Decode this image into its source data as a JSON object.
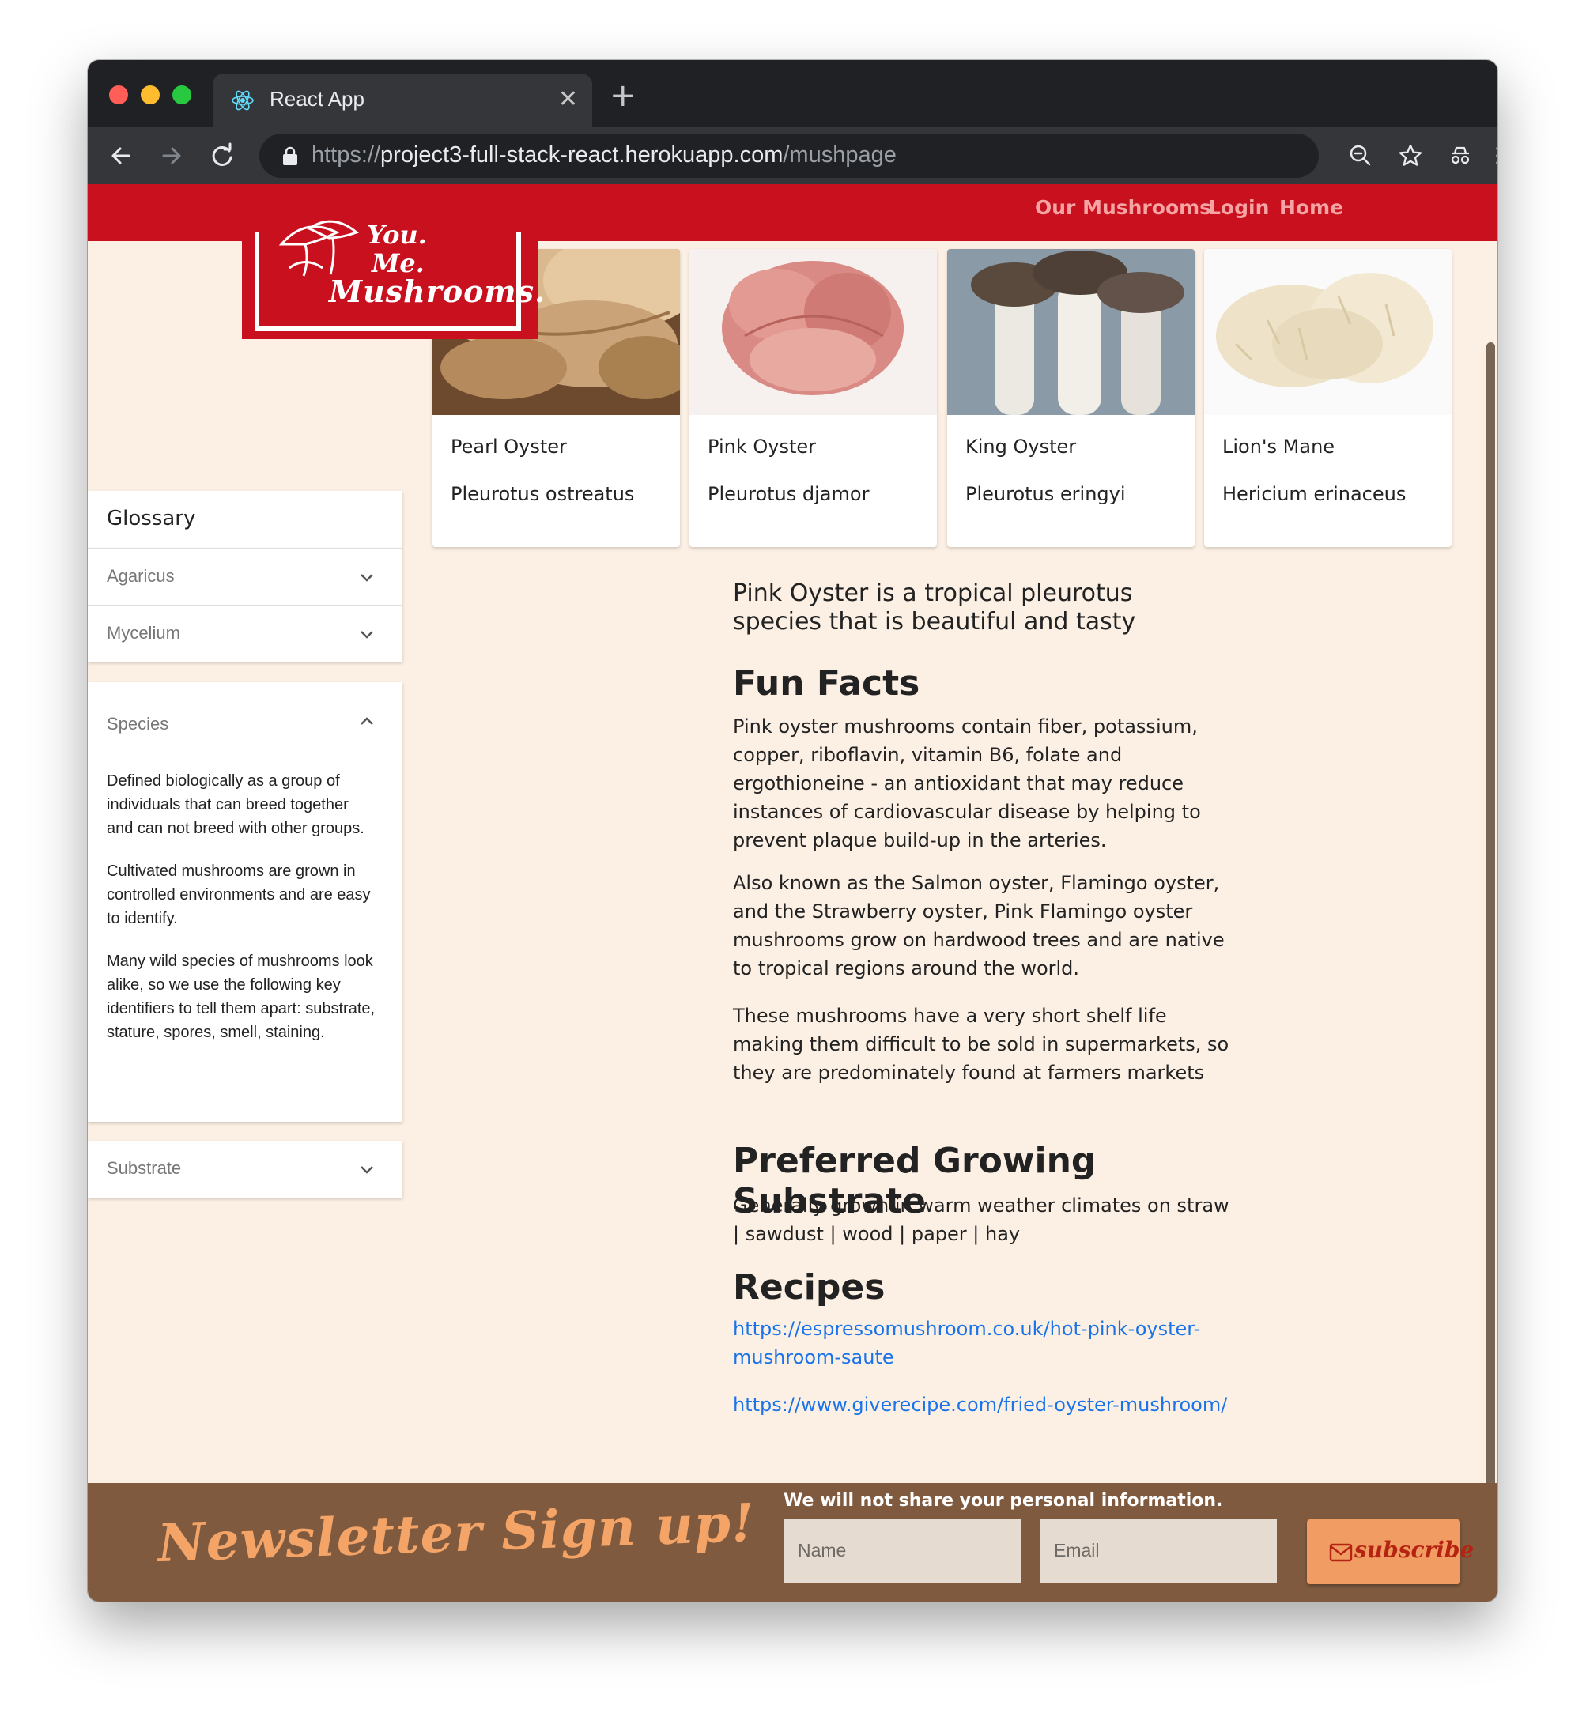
{
  "browser": {
    "tab_title": "React App",
    "url_scheme": "https://",
    "url_host": "project3-full-stack-react.herokuapp.com",
    "url_path": "/mushpage"
  },
  "nav": {
    "links": [
      "Our Mushrooms",
      "Login",
      "Home"
    ]
  },
  "logo": {
    "line1": "You.",
    "line2": "Me.",
    "line3": "Mushrooms."
  },
  "glossary": {
    "title": "Glossary",
    "items": [
      {
        "label": "Agaricus",
        "expanded": false
      },
      {
        "label": "Mycelium",
        "expanded": false
      },
      {
        "label": "Species",
        "expanded": true
      },
      {
        "label": "Substrate",
        "expanded": false
      }
    ],
    "species_body": [
      "Defined biologically as a group of individuals that can breed together and can not breed with other groups.",
      "Cultivated mushrooms are grown in controlled environments and are easy to identify.",
      "Many wild species of mushrooms look alike, so we use the following key identifiers to tell them apart: substrate, stature, spores, smell, staining."
    ]
  },
  "cards": [
    {
      "name": "Pearl Oyster",
      "scientific": "Pleurotus ostreatus"
    },
    {
      "name": "Pink Oyster",
      "scientific": "Pleurotus djamor"
    },
    {
      "name": "King Oyster",
      "scientific": "Pleurotus eringyi"
    },
    {
      "name": "Lion's Mane",
      "scientific": "Hericium erinaceus"
    }
  ],
  "detail": {
    "intro": "Pink Oyster is a tropical pleurotus species that is beautiful and tasty",
    "fun_facts_heading": "Fun Facts",
    "fun_facts": [
      "Pink oyster mushrooms contain fiber, potassium, copper, riboflavin, vitamin B6, folate and ergothioneine - an antioxidant that may reduce instances of cardiovascular disease by helping to prevent plaque build-up in the arteries.",
      "Also known as the Salmon oyster, Flamingo oyster, and the Strawberry oyster, Pink Flamingo oyster mushrooms grow on hardwood trees and are native to tropical regions around the world.",
      "These mushrooms have a very short shelf life making them difficult to be sold in supermarkets, so they are predominately found at farmers markets"
    ],
    "substrate_heading": "Preferred Growing Substrate",
    "substrate_text": "Generally grown in warm weather climates on straw | sawdust | wood | paper | hay",
    "recipes_heading": "Recipes",
    "recipes": [
      "https://espressomushroom.co.uk/hot-pink-oyster-mushroom-saute",
      "https://www.giverecipe.com/fried-oyster-mushroom/"
    ]
  },
  "newsletter": {
    "title": "Newsletter Sign up!",
    "note": "We will not share your personal information.",
    "name_placeholder": "Name",
    "email_placeholder": "Email",
    "subscribe_label": "subscribe"
  },
  "colors": {
    "nav_red": "#c8101e",
    "page_bg": "#fcf0e4",
    "footer_brown": "#7f5a3f",
    "accent_orange": "#f09c62",
    "link_blue": "#1a73e8"
  }
}
